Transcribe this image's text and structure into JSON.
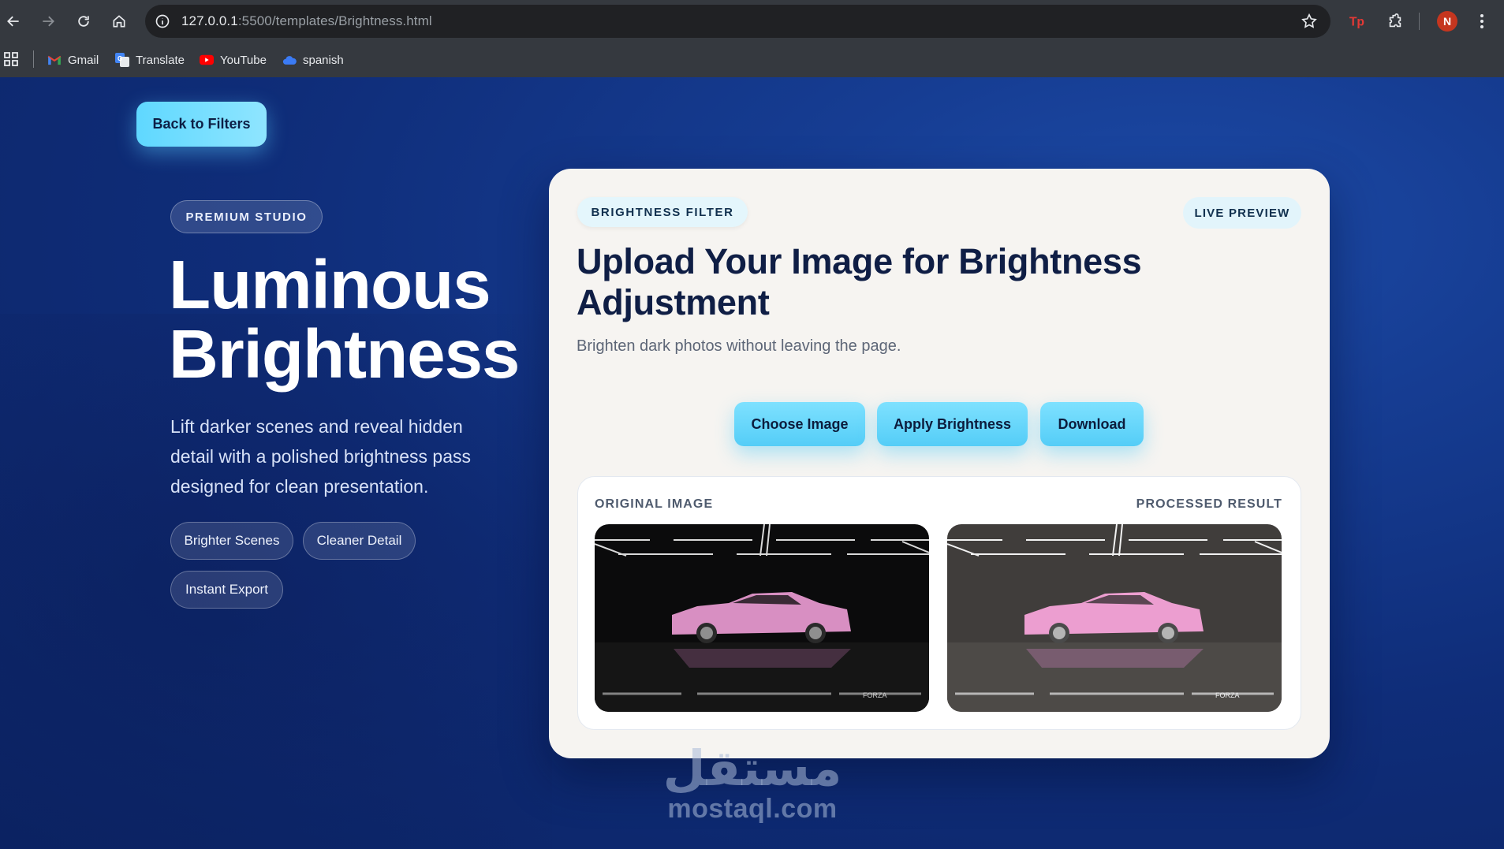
{
  "browser": {
    "url_host": "127.0.0.1",
    "url_path": ":5500/templates/Brightness.html",
    "avatar_initial": "N",
    "bookmarks": [
      {
        "label": "Gmail",
        "icon": "gmail-icon"
      },
      {
        "label": "Translate",
        "icon": "translate-icon"
      },
      {
        "label": "YouTube",
        "icon": "youtube-icon"
      },
      {
        "label": "spanish",
        "icon": "cloud-icon"
      }
    ]
  },
  "page": {
    "back_label": "Back to Filters",
    "badge": "PREMIUM STUDIO",
    "hero_title_line1": "Luminous",
    "hero_title_line2": "Brightness",
    "hero_description": "Lift darker scenes and reveal hidden detail with a polished brightness pass designed for clean presentation.",
    "chips": [
      "Brighter Scenes",
      "Cleaner Detail",
      "Instant Export"
    ]
  },
  "card": {
    "tag": "BRIGHTNESS FILTER",
    "live_tag": "LIVE PREVIEW",
    "title": "Upload Your Image for Brightness Adjustment",
    "subtitle": "Brighten dark photos without leaving the page.",
    "buttons": {
      "choose": "Choose Image",
      "apply": "Apply Brightness",
      "download": "Download"
    },
    "original_label": "ORIGINAL IMAGE",
    "processed_label": "PROCESSED RESULT"
  },
  "watermark": {
    "arabic": "مستقل",
    "latin": "mostaql.com"
  },
  "colors": {
    "accent": "#5fd8ff",
    "card_bg": "#f6f4f1",
    "page_bg": "#0f2d79",
    "title": "#0f1e45"
  }
}
